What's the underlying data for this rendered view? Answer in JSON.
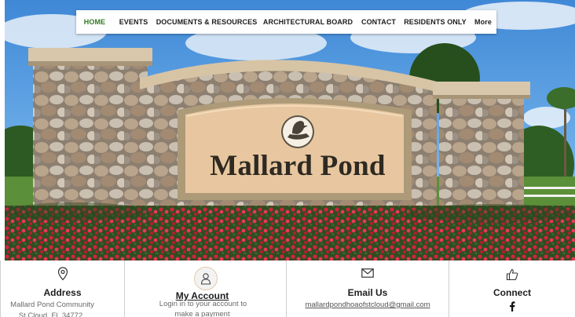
{
  "nav": {
    "items": [
      {
        "label": "HOME",
        "active": true
      },
      {
        "label": "EVENTS",
        "active": false
      },
      {
        "label": "DOCUMENTS & RESOURCES",
        "active": false
      },
      {
        "label": "ARCHITECTURAL BOARD",
        "active": false
      },
      {
        "label": "CONTACT",
        "active": false
      },
      {
        "label": "RESIDENTS ONLY",
        "active": false
      },
      {
        "label": "More",
        "active": false
      }
    ],
    "active_color": "#2f7a1f"
  },
  "hero": {
    "sign_text": "Mallard Pond",
    "emblem_icon": "duck-emblem-icon"
  },
  "footer": {
    "address": {
      "icon": "map-pin-icon",
      "title": "Address",
      "line1": "Mallard Pond Community",
      "line2": "St Cloud, FL 34772"
    },
    "account": {
      "icon": "user-icon",
      "title": "My Account",
      "line1": "Login in to your account to",
      "line2": "make a payment"
    },
    "email": {
      "icon": "envelope-icon",
      "title": "Email Us",
      "address": "mallardpondhoaofstcloud@gmail.com"
    },
    "connect": {
      "icon": "thumbs-up-icon",
      "title": "Connect",
      "social_icon": "facebook-icon"
    }
  }
}
